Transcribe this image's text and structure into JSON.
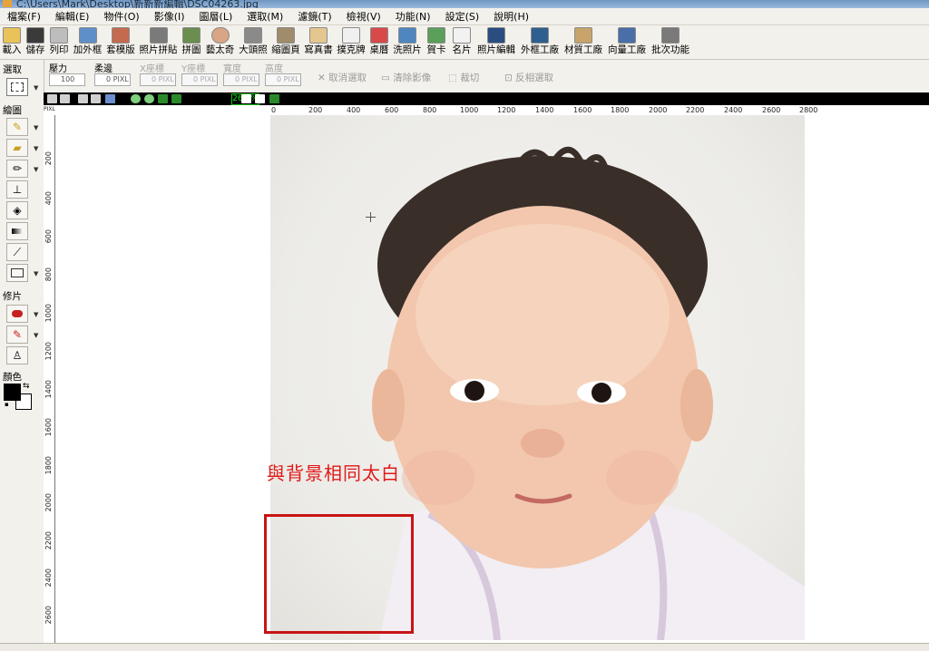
{
  "window": {
    "title": "C:\\Users\\Mark\\Desktop\\新新新編輯\\DSC04263.jpg"
  },
  "menu": [
    "檔案(F)",
    "編輯(E)",
    "物件(O)",
    "影像(I)",
    "圖層(L)",
    "選取(M)",
    "濾鏡(T)",
    "檢視(V)",
    "功能(N)",
    "設定(S)",
    "說明(H)"
  ],
  "toolbar": [
    {
      "label": "載入",
      "icon": "folder-open-icon"
    },
    {
      "label": "儲存",
      "icon": "save-icon"
    },
    {
      "label": "列印",
      "icon": "printer-icon"
    },
    {
      "label": "加外框",
      "icon": "frame-icon"
    },
    {
      "label": "套模版",
      "icon": "template-icon"
    },
    {
      "label": "照片拼貼",
      "icon": "collage-icon"
    },
    {
      "label": "拼圖",
      "icon": "puzzle-icon"
    },
    {
      "label": "藝太奇",
      "icon": "art-icon"
    },
    {
      "label": "大頭照",
      "icon": "portrait-icon"
    },
    {
      "label": "縮圖頁",
      "icon": "thumbnail-icon"
    },
    {
      "label": "寫真書",
      "icon": "photobook-icon"
    },
    {
      "label": "撲克牌",
      "icon": "poker-icon"
    },
    {
      "label": "桌曆",
      "icon": "calendar-icon"
    },
    {
      "label": "洗照片",
      "icon": "print-photo-icon"
    },
    {
      "label": "賀卡",
      "icon": "card-icon"
    },
    {
      "label": "名片",
      "icon": "namecard-icon"
    },
    {
      "label": "照片編輯",
      "icon": "photo-edit-icon"
    },
    {
      "label": "外框工廠",
      "icon": "frame-factory-icon"
    },
    {
      "label": "材質工廠",
      "icon": "texture-factory-icon"
    },
    {
      "label": "向量工廠",
      "icon": "vector-factory-icon"
    },
    {
      "label": "批次功能",
      "icon": "batch-icon"
    }
  ],
  "options": {
    "pressure_label": "壓力",
    "pressure_value": "100",
    "feather_label": "柔邊",
    "feather_value": "0",
    "x_label": "X座標",
    "y_label": "Y座標",
    "width_label": "寬度",
    "height_label": "高度",
    "unit": "PIXL",
    "field_zero": "0",
    "cancel_selection": "取消選取",
    "clear_image": "清除影像",
    "crop": "裁切",
    "invert_selection": "反相選取"
  },
  "left": {
    "select_label": "選取",
    "draw_label": "繪圖",
    "retouch_label": "修片",
    "color_label": "顏色",
    "fg_color": "#000000",
    "bg_color": "#ffffff"
  },
  "view": {
    "zoom": "26.2%"
  },
  "ruler": {
    "top_labels": [
      "0",
      "200",
      "400",
      "600",
      "800",
      "1000",
      "1200",
      "1400",
      "1600",
      "1800",
      "2000",
      "2200",
      "2400",
      "2600",
      "2800"
    ],
    "left_labels": [
      "200",
      "400",
      "600",
      "800",
      "1000",
      "1200",
      "1400",
      "1600",
      "1800",
      "2000",
      "2200",
      "2400",
      "2600"
    ],
    "unit": "PIXL"
  },
  "annotation": {
    "text": "與背景相同太白",
    "color": "#e01818"
  }
}
